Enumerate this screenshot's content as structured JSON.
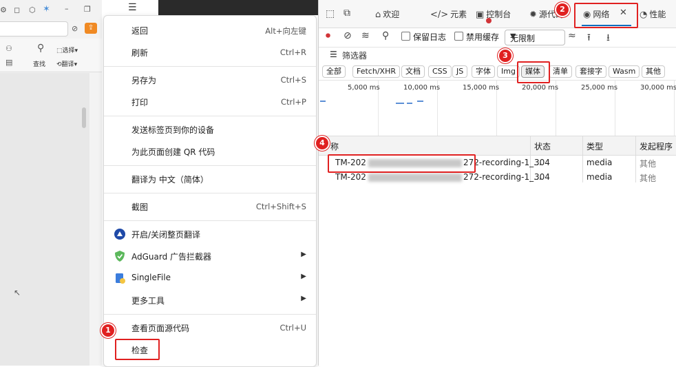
{
  "left_app": {
    "toolbar": {
      "find": "查找",
      "select": "选择",
      "translate": "翻译"
    }
  },
  "context_menu": {
    "items": [
      {
        "label": "返回",
        "shortcut": "Alt+向左键"
      },
      {
        "label": "刷新",
        "shortcut": "Ctrl+R"
      },
      {
        "label": "另存为",
        "shortcut": "Ctrl+S"
      },
      {
        "label": "打印",
        "shortcut": "Ctrl+P"
      },
      {
        "label": "发送标签页到你的设备",
        "shortcut": ""
      },
      {
        "label": "为此页面创建 QR 代码",
        "shortcut": ""
      },
      {
        "label": "翻译为 中文（简体）",
        "shortcut": ""
      },
      {
        "label": "截图",
        "shortcut": "Ctrl+Shift+S"
      },
      {
        "label": "开启/关闭整页翻译",
        "shortcut": ""
      },
      {
        "label": "AdGuard 广告拦截器",
        "shortcut": ""
      },
      {
        "label": "SingleFile",
        "shortcut": ""
      },
      {
        "label": "更多工具",
        "shortcut": ""
      },
      {
        "label": "查看页面源代码",
        "shortcut": "Ctrl+U"
      },
      {
        "label": "检查",
        "shortcut": ""
      }
    ]
  },
  "devtools": {
    "tabs": {
      "welcome": "欢迎",
      "elements": "元素",
      "console": "控制台",
      "sources": "源代码",
      "network": "网络",
      "performance": "性能"
    },
    "toolbar": {
      "preserve_log": "保留日志",
      "disable_cache": "禁用缓存",
      "throttle": "无限制"
    },
    "filter_label": "筛选器",
    "type_filters": [
      "全部",
      "Fetch/XHR",
      "文档",
      "CSS",
      "JS",
      "字体",
      "Img",
      "媒体",
      "清单",
      "套接字",
      "Wasm",
      "其他"
    ],
    "timeline_ticks": [
      "5,000 ms",
      "10,000 ms",
      "15,000 ms",
      "20,000 ms",
      "25,000 ms",
      "30,000 ms"
    ],
    "columns": {
      "name": "称",
      "status": "状态",
      "type": "类型",
      "initiator": "发起程序"
    },
    "rows": [
      {
        "name_prefix": "TM-202",
        "name_suffix": "272-recording-1_...",
        "status": "304",
        "type": "media",
        "initiator": "其他"
      },
      {
        "name_prefix": "TM-202",
        "name_suffix": "272-recording-1_...",
        "status": "304",
        "type": "media",
        "initiator": "其他"
      }
    ]
  },
  "annotations": {
    "step1": "1",
    "step2": "2",
    "step3": "3",
    "step4": "4"
  },
  "colors": {
    "highlight": "#e02020",
    "accent": "#0f6cbd",
    "orange": "#f08a24"
  }
}
